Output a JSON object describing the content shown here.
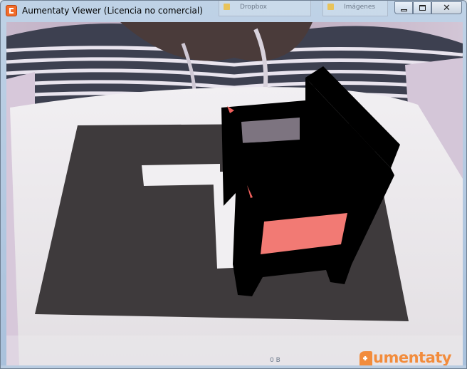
{
  "window": {
    "title": "Aumentaty Viewer (Licencia no comercial)",
    "icon": "aumentaty-app-icon",
    "controls": {
      "minimize": "minimize-icon",
      "maximize": "maximize-icon",
      "close_label": "✕"
    }
  },
  "background_tabs": [
    {
      "label": "Dropbox",
      "icon": "folder-icon"
    },
    {
      "label": "Imágenes",
      "icon": "folder-icon"
    }
  ],
  "viewport": {
    "scene": "ar-camera-feed",
    "model": "chair-3d-model",
    "colors": {
      "seat": "#f27a74",
      "model_body": "#000000",
      "marker_fill": "#3e3a3c",
      "paper": "#efeef0"
    }
  },
  "brand": {
    "text": "umentaty",
    "mark_icon": "aumentaty-logo-icon",
    "color": "#f28c3c"
  },
  "taskbar_ghost": {
    "text": "0 B"
  }
}
